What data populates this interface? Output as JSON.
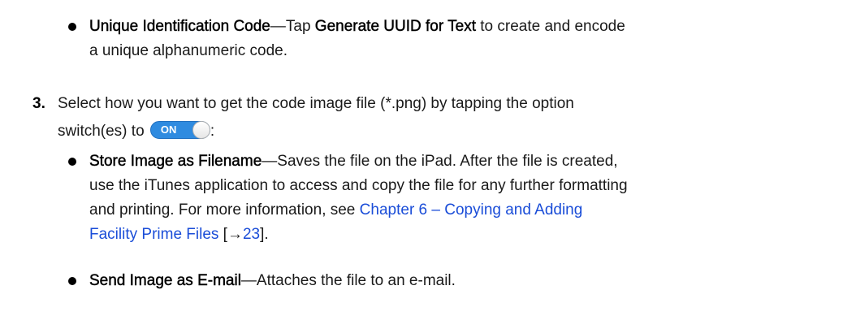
{
  "top_bullet": {
    "term": "Unique Identification Code",
    "text_pre": "—Tap ",
    "button_name": "Generate UUID for Text",
    "text_post_line1": " to create and encode",
    "text_line2": "a unique alphanumeric code."
  },
  "step3": {
    "number": "3.",
    "text_line1": "Select how you want to get the code image file (*.png) by tapping the option",
    "text_line2_pre": "switch(es) to",
    "text_line2_post": ":",
    "toggle_label": "ON",
    "toggle_color": "#2f8be0"
  },
  "bullet_store": {
    "term": "Store Image as Filename",
    "line1_rest": "—Saves the file on the iPad. After the file is created,",
    "line2": "use the iTunes application to access and copy the file for any further formatting",
    "line3_pre": "and printing. For more information, see ",
    "link_line3": "Chapter 6 – Copying and Adding",
    "link_line4": "Facility Prime Files",
    "ref_pre": " [→",
    "ref_page": "23",
    "ref_post": "]."
  },
  "bullet_email": {
    "term": "Send Image as E-mail",
    "rest": "—Attaches the file to an e-mail."
  },
  "colors": {
    "link": "#1a4dd8",
    "text": "#1a1a1a"
  }
}
